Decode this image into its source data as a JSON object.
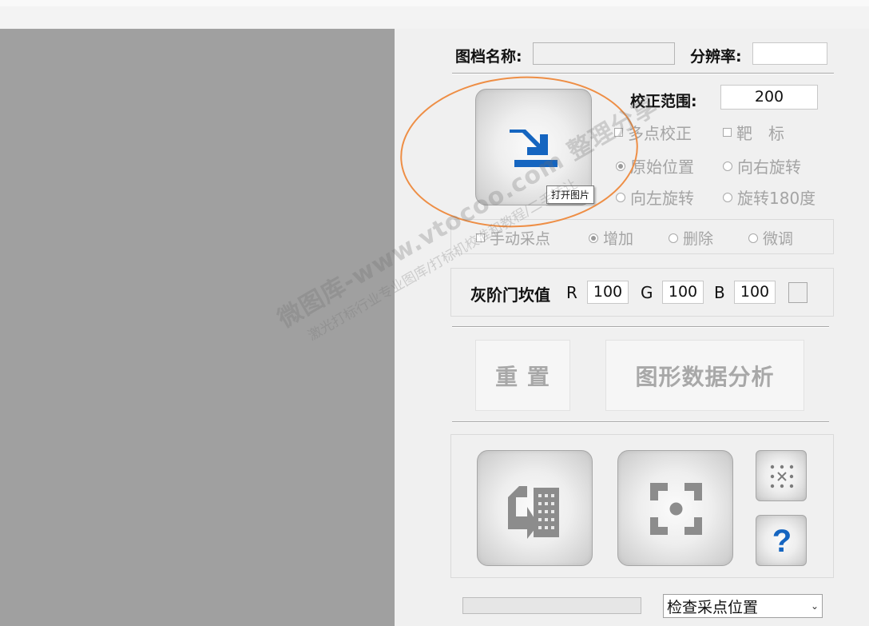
{
  "header": {
    "file_name_label": "图档名称:",
    "file_name_value": "",
    "resolution_label": "分辨率:",
    "resolution_value": ""
  },
  "calibration": {
    "range_label": "校正范围:",
    "range_value": "200",
    "multi_point": "多点校正",
    "target": "靶　标",
    "rot_original": "原始位置",
    "rot_right": "向右旋转",
    "rot_left": "向左旋转",
    "rot_180": "旋转180度",
    "selected_rotation": "原始位置"
  },
  "open_button": {
    "tooltip": "打开图片",
    "icon": "import-arrow-icon",
    "icon_color": "#1565c0"
  },
  "manual_sampling": {
    "label": "手动采点",
    "add": "增加",
    "delete": "删除",
    "fine_tune": "微调"
  },
  "gray_threshold": {
    "label": "灰阶门坎值",
    "r_label": "R",
    "r_value": "100",
    "g_label": "G",
    "g_value": "100",
    "b_label": "B",
    "b_value": "100"
  },
  "actions": {
    "reset": "重 置",
    "analyze": "图形数据分析"
  },
  "tools": {
    "transfer_icon": "data-transfer-icon",
    "target_icon": "focus-target-icon",
    "grid_icon": "dot-grid-icon",
    "help_icon": "help-icon",
    "help_color": "#1565c0"
  },
  "footer": {
    "progress": 0,
    "dropdown_value": "检查采点位置"
  },
  "watermark": {
    "line1": "微图库-www.vtocoo.com 整理分享",
    "line2": "激光打标行业专业图库/打标机校准和教程/二手转让"
  },
  "colors": {
    "canvas": "#a0a0a0",
    "panel": "#f0f0f0",
    "annotation_ring": "#ee8e45"
  }
}
